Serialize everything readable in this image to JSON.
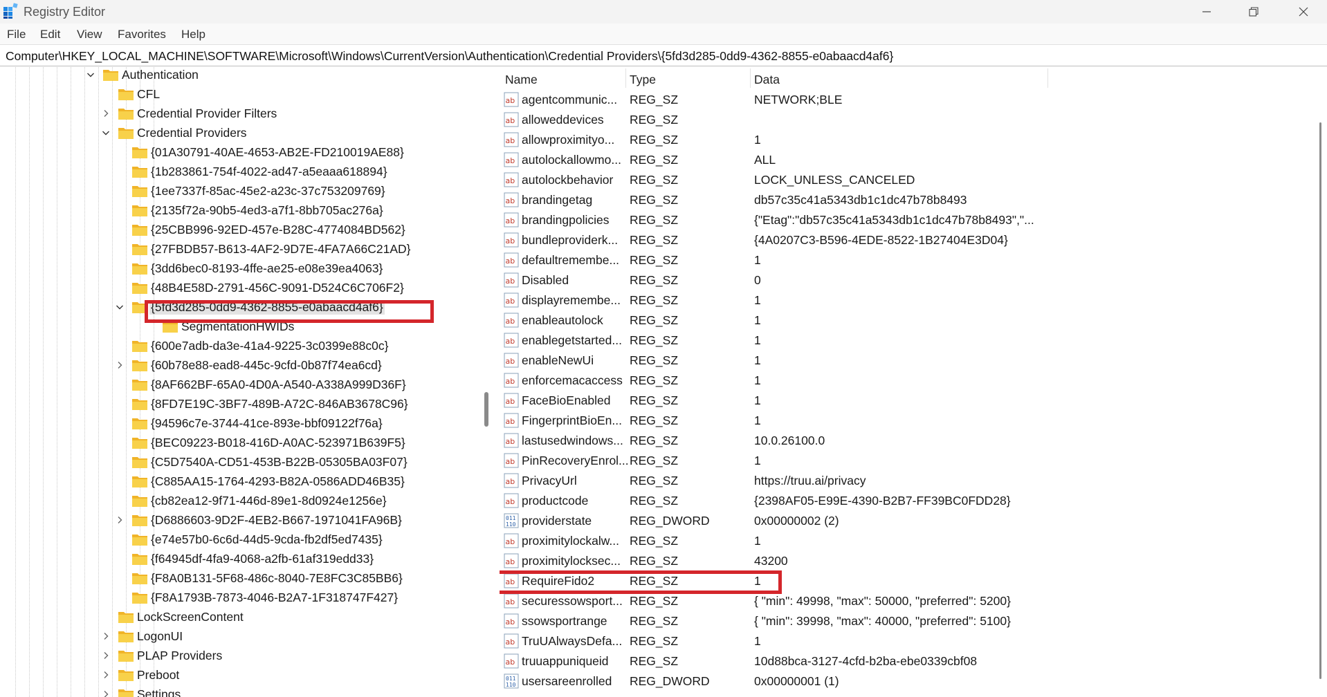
{
  "window": {
    "title": "Registry Editor"
  },
  "menu": [
    "File",
    "Edit",
    "View",
    "Favorites",
    "Help"
  ],
  "address": "Computer\\HKEY_LOCAL_MACHINE\\SOFTWARE\\Microsoft\\Windows\\CurrentVersion\\Authentication\\Credential Providers\\{5fd3d285-0dd9-4362-8855-e0abaacd4af6}",
  "tree": [
    {
      "label": "Authentication",
      "level": 0,
      "expander": "expanded"
    },
    {
      "label": "CFL",
      "level": 1,
      "expander": "none"
    },
    {
      "label": "Credential Provider Filters",
      "level": 1,
      "expander": "collapsed"
    },
    {
      "label": "Credential Providers",
      "level": 1,
      "expander": "expanded"
    },
    {
      "label": "{01A30791-40AE-4653-AB2E-FD210019AE88}",
      "level": 2,
      "expander": "none"
    },
    {
      "label": "{1b283861-754f-4022-ad47-a5eaaa618894}",
      "level": 2,
      "expander": "none"
    },
    {
      "label": "{1ee7337f-85ac-45e2-a23c-37c753209769}",
      "level": 2,
      "expander": "none"
    },
    {
      "label": "{2135f72a-90b5-4ed3-a7f1-8bb705ac276a}",
      "level": 2,
      "expander": "none"
    },
    {
      "label": "{25CBB996-92ED-457e-B28C-4774084BD562}",
      "level": 2,
      "expander": "none"
    },
    {
      "label": "{27FBDB57-B613-4AF2-9D7E-4FA7A66C21AD}",
      "level": 2,
      "expander": "none"
    },
    {
      "label": "{3dd6bec0-8193-4ffe-ae25-e08e39ea4063}",
      "level": 2,
      "expander": "none"
    },
    {
      "label": "{48B4E58D-2791-456C-9091-D524C6C706F2}",
      "level": 2,
      "expander": "none"
    },
    {
      "label": "{5fd3d285-0dd9-4362-8855-e0abaacd4af6}",
      "level": 2,
      "expander": "expanded",
      "selected": true
    },
    {
      "label": "SegmentationHWIDs",
      "level": 3,
      "expander": "none"
    },
    {
      "label": "{600e7adb-da3e-41a4-9225-3c0399e88c0c}",
      "level": 2,
      "expander": "none"
    },
    {
      "label": "{60b78e88-ead8-445c-9cfd-0b87f74ea6cd}",
      "level": 2,
      "expander": "collapsed"
    },
    {
      "label": "{8AF662BF-65A0-4D0A-A540-A338A999D36F}",
      "level": 2,
      "expander": "none"
    },
    {
      "label": "{8FD7E19C-3BF7-489B-A72C-846AB3678C96}",
      "level": 2,
      "expander": "none"
    },
    {
      "label": "{94596c7e-3744-41ce-893e-bbf09122f76a}",
      "level": 2,
      "expander": "none"
    },
    {
      "label": "{BEC09223-B018-416D-A0AC-523971B639F5}",
      "level": 2,
      "expander": "none"
    },
    {
      "label": "{C5D7540A-CD51-453B-B22B-05305BA03F07}",
      "level": 2,
      "expander": "none"
    },
    {
      "label": "{C885AA15-1764-4293-B82A-0586ADD46B35}",
      "level": 2,
      "expander": "none"
    },
    {
      "label": "{cb82ea12-9f71-446d-89e1-8d0924e1256e}",
      "level": 2,
      "expander": "none"
    },
    {
      "label": "{D6886603-9D2F-4EB2-B667-1971041FA96B}",
      "level": 2,
      "expander": "collapsed"
    },
    {
      "label": "{e74e57b0-6c6d-44d5-9cda-fb2df5ed7435}",
      "level": 2,
      "expander": "none"
    },
    {
      "label": "{f64945df-4fa9-4068-a2fb-61af319edd33}",
      "level": 2,
      "expander": "none"
    },
    {
      "label": "{F8A0B131-5F68-486c-8040-7E8FC3C85BB6}",
      "level": 2,
      "expander": "none"
    },
    {
      "label": "{F8A1793B-7873-4046-B2A7-1F318747F427}",
      "level": 2,
      "expander": "none"
    },
    {
      "label": "LockScreenContent",
      "level": 1,
      "expander": "none"
    },
    {
      "label": "LogonUI",
      "level": 1,
      "expander": "collapsed"
    },
    {
      "label": "PLAP Providers",
      "level": 1,
      "expander": "collapsed"
    },
    {
      "label": "Preboot",
      "level": 1,
      "expander": "collapsed"
    },
    {
      "label": "Settings",
      "level": 1,
      "expander": "collapsed"
    }
  ],
  "columns": {
    "name": "Name",
    "type": "Type",
    "data": "Data"
  },
  "values": [
    {
      "name": "agentcommunic...",
      "type": "REG_SZ",
      "data": "NETWORK;BLE",
      "icon": "string-value-icon"
    },
    {
      "name": "alloweddevices",
      "type": "REG_SZ",
      "data": "",
      "icon": "string-value-icon"
    },
    {
      "name": "allowproximityo...",
      "type": "REG_SZ",
      "data": "1",
      "icon": "string-value-icon"
    },
    {
      "name": "autolockallowmo...",
      "type": "REG_SZ",
      "data": "ALL",
      "icon": "string-value-icon"
    },
    {
      "name": "autolockbehavior",
      "type": "REG_SZ",
      "data": "LOCK_UNLESS_CANCELED",
      "icon": "string-value-icon"
    },
    {
      "name": "brandingetag",
      "type": "REG_SZ",
      "data": "db57c35c41a5343db1c1dc47b78b8493",
      "icon": "string-value-icon"
    },
    {
      "name": "brandingpolicies",
      "type": "REG_SZ",
      "data": "{\"Etag\":\"db57c35c41a5343db1c1dc47b78b8493\",\"...",
      "icon": "string-value-icon"
    },
    {
      "name": "bundleproviderk...",
      "type": "REG_SZ",
      "data": "{4A0207C3-B596-4EDE-8522-1B27404E3D04}",
      "icon": "string-value-icon"
    },
    {
      "name": "defaultremembe...",
      "type": "REG_SZ",
      "data": "1",
      "icon": "string-value-icon"
    },
    {
      "name": "Disabled",
      "type": "REG_SZ",
      "data": "0",
      "icon": "string-value-icon"
    },
    {
      "name": "displayremembe...",
      "type": "REG_SZ",
      "data": "1",
      "icon": "string-value-icon"
    },
    {
      "name": "enableautolock",
      "type": "REG_SZ",
      "data": "1",
      "icon": "string-value-icon"
    },
    {
      "name": "enablegetstarted...",
      "type": "REG_SZ",
      "data": "1",
      "icon": "string-value-icon"
    },
    {
      "name": "enableNewUi",
      "type": "REG_SZ",
      "data": "1",
      "icon": "string-value-icon"
    },
    {
      "name": "enforcemacaccess",
      "type": "REG_SZ",
      "data": "1",
      "icon": "string-value-icon"
    },
    {
      "name": "FaceBioEnabled",
      "type": "REG_SZ",
      "data": "1",
      "icon": "string-value-icon"
    },
    {
      "name": "FingerprintBioEn...",
      "type": "REG_SZ",
      "data": "1",
      "icon": "string-value-icon"
    },
    {
      "name": "lastusedwindows...",
      "type": "REG_SZ",
      "data": "10.0.26100.0",
      "icon": "string-value-icon"
    },
    {
      "name": "PinRecoveryEnrol...",
      "type": "REG_SZ",
      "data": "1",
      "icon": "string-value-icon"
    },
    {
      "name": "PrivacyUrl",
      "type": "REG_SZ",
      "data": "https://truu.ai/privacy",
      "icon": "string-value-icon"
    },
    {
      "name": "productcode",
      "type": "REG_SZ",
      "data": "{2398AF05-E99E-4390-B2B7-FF39BC0FDD28}",
      "icon": "string-value-icon"
    },
    {
      "name": "providerstate",
      "type": "REG_DWORD",
      "data": "0x00000002 (2)",
      "icon": "dword-value-icon"
    },
    {
      "name": "proximitylockalw...",
      "type": "REG_SZ",
      "data": "1",
      "icon": "string-value-icon"
    },
    {
      "name": "proximitylocksec...",
      "type": "REG_SZ",
      "data": "43200",
      "icon": "string-value-icon"
    },
    {
      "name": "RequireFido2",
      "type": "REG_SZ",
      "data": "1",
      "icon": "string-value-icon",
      "highlight": true
    },
    {
      "name": "securessowsport...",
      "type": "REG_SZ",
      "data": "{  \"min\": 49998,  \"max\": 50000,  \"preferred\": 5200}",
      "icon": "string-value-icon"
    },
    {
      "name": "ssowsportrange",
      "type": "REG_SZ",
      "data": "{  \"min\": 39998,  \"max\": 40000,  \"preferred\": 5100}",
      "icon": "string-value-icon"
    },
    {
      "name": "TruUAlwaysDefa...",
      "type": "REG_SZ",
      "data": "1",
      "icon": "string-value-icon"
    },
    {
      "name": "truuappuniqueid",
      "type": "REG_SZ",
      "data": "10d88bca-3127-4cfd-b2ba-ebe0339cbf08",
      "icon": "string-value-icon"
    },
    {
      "name": "usersareenrolled",
      "type": "REG_DWORD",
      "data": "0x00000001 (1)",
      "icon": "dword-value-icon"
    }
  ],
  "colors": {
    "highlight": "#d4262b",
    "folder": "#f4c23a",
    "selection": "#e3e3e3"
  }
}
